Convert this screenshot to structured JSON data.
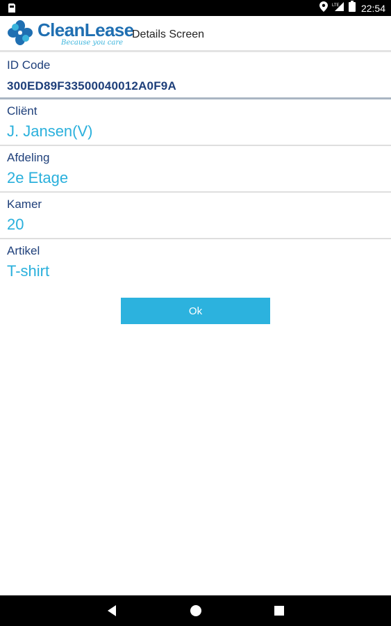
{
  "status_bar": {
    "time": "22:54",
    "icons": [
      "sim-card-icon",
      "location-icon",
      "signal-icon",
      "battery-icon"
    ]
  },
  "header": {
    "logo_text": "CleanLease",
    "logo_tagline": "Because you care",
    "title": "Details Screen",
    "brand_color": "#1f6fb2",
    "accent_color": "#2cb2de"
  },
  "fields": [
    {
      "label": "ID Code",
      "value": "300ED89F33500040012A0F9A"
    },
    {
      "label": "Cliënt",
      "value": "J. Jansen(V)"
    },
    {
      "label": "Afdeling",
      "value": "2e Etage"
    },
    {
      "label": "Kamer",
      "value": "20"
    },
    {
      "label": "Artikel",
      "value": "T-shirt"
    }
  ],
  "ok_button": {
    "label": "Ok"
  },
  "nav_bar": {
    "icons": [
      "back-icon",
      "home-icon",
      "recents-icon"
    ]
  }
}
